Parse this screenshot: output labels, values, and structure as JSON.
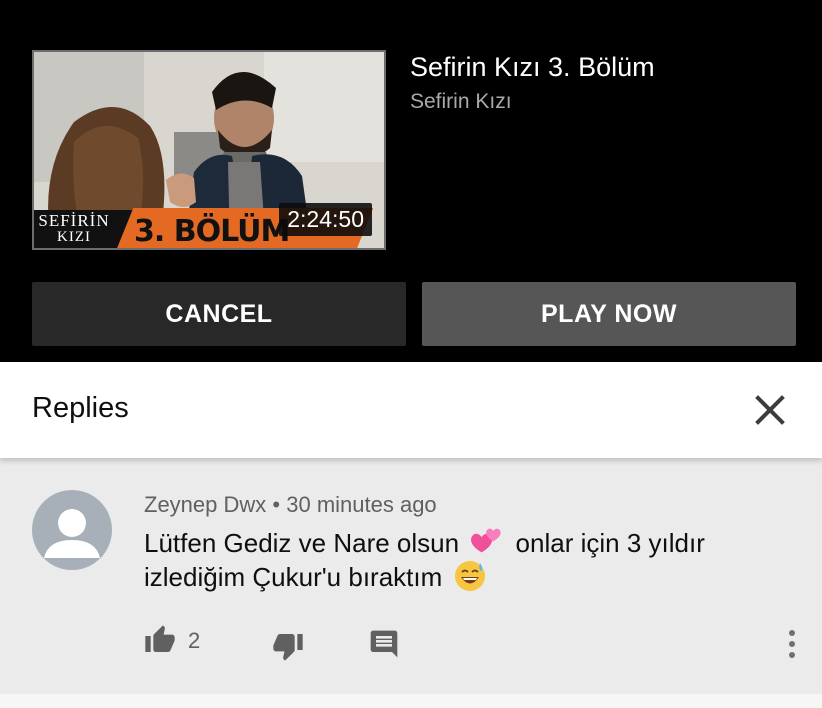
{
  "up_next": {
    "thumbnail": {
      "logo_line1": "SEFİRİN",
      "logo_line2": "KIZI",
      "episode_label": "3. BÖLÜM",
      "duration": "2:24:50"
    },
    "video_title": "Sefirin Kızı 3. Bölüm",
    "channel_name": "Sefirin Kızı",
    "cancel_label": "CANCEL",
    "play_now_label": "PLAY NOW"
  },
  "replies_panel": {
    "title": "Replies",
    "close_icon": "close-icon"
  },
  "reply": {
    "author": "Zeynep Dwx",
    "separator": "•",
    "time_ago": "30 minutes ago",
    "text_part1": "Lütfen Gediz ve Nare olsun",
    "text_part2": "onlar için 3 yıldır",
    "text_part3": "izlediğim Çukur'u bıraktım",
    "emojis": [
      "two-hearts",
      "grinning-sweat"
    ],
    "like_count": "2",
    "icons": [
      "thumbs-up-icon",
      "thumbs-down-icon",
      "reply-icon",
      "more-vert-icon"
    ]
  },
  "colors": {
    "panel_bg": "#000000",
    "cancel_bg": "#282828",
    "play_bg": "#565656",
    "reply_bg": "#ebebeb",
    "ribbon_orange": "#e46a23"
  }
}
